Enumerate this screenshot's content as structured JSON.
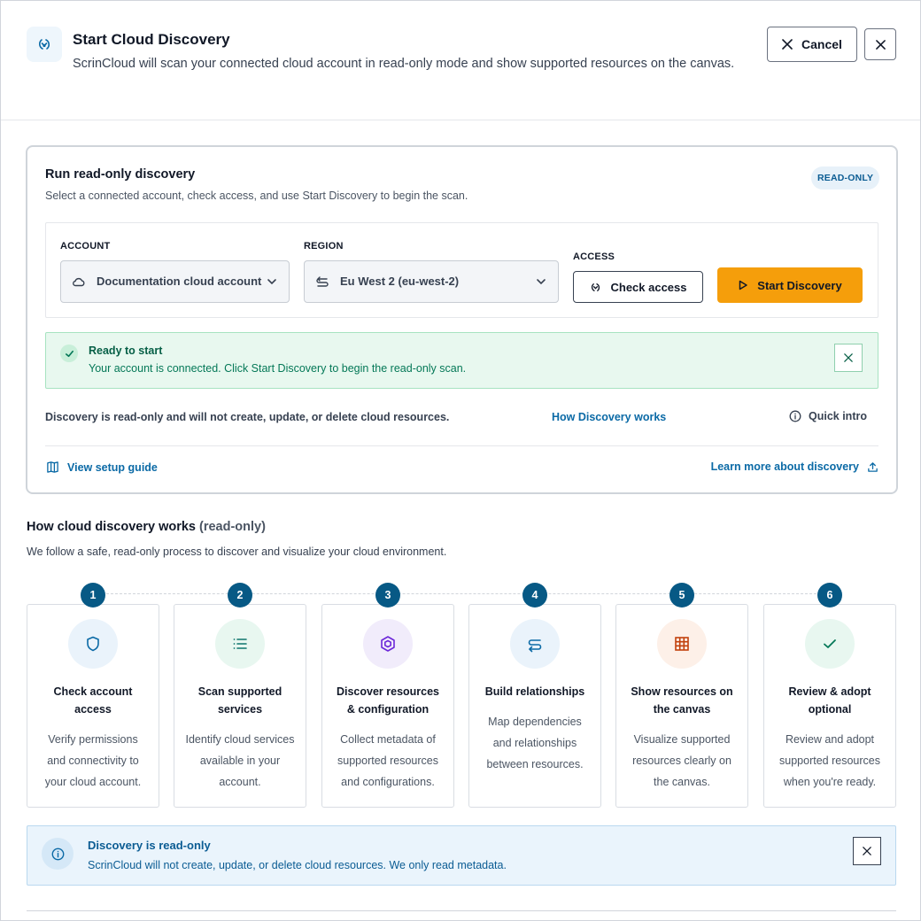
{
  "header": {
    "title": "Start Cloud Discovery",
    "subtitle": "ScrinCloud will scan your connected cloud account in read-only mode and show supported resources on the canvas.",
    "cancel_label": "Cancel",
    "icon": "discovery-icon"
  },
  "discovery": {
    "title": "Run read-only discovery",
    "subtitle": "Select a connected account, check access, and use Start Discovery to begin the scan.",
    "badge": "READ-ONLY",
    "account_label": "ACCOUNT",
    "account_value": "Documentation cloud account",
    "region_label": "REGION",
    "region_value": "Eu West 2 (eu-west-2)",
    "access_label": "ACCESS",
    "check_access_label": "Check access",
    "start_label": "Start Discovery"
  },
  "status": {
    "title": "Ready to start",
    "message": "Your account is connected. Click Start Discovery to begin the read-only scan."
  },
  "footer_links": {
    "note": "Discovery is read-only and will not create, update, or delete cloud resources.",
    "how_link": "How Discovery works",
    "quick_intro": "Quick intro",
    "setup_guide": "View setup guide",
    "learn_more": "Learn more about discovery"
  },
  "how": {
    "title": "How cloud discovery works",
    "title_suffix": "(read-only)",
    "subtitle": "We follow a safe, read-only process to discover and visualize your cloud environment.",
    "steps": [
      {
        "num": "1",
        "title": "Check account access",
        "desc": "Verify permissions and connectivity to your cloud account.",
        "icon": "shield-icon",
        "color": "#0b6aa6",
        "bg": "#eaf3fb"
      },
      {
        "num": "2",
        "title": "Scan supported services",
        "desc": "Identify cloud services available in your account.",
        "icon": "list-icon",
        "color": "#0f766e",
        "bg": "#e8f7f0"
      },
      {
        "num": "3",
        "title": "Discover resources & configuration",
        "desc": "Collect metadata of supported resources and configurations.",
        "icon": "hexagon-icon",
        "color": "#6d28d9",
        "bg": "#f1ecfb"
      },
      {
        "num": "4",
        "title": "Build relationships",
        "desc": "Map dependencies and relationships between resources.",
        "icon": "link-icon",
        "color": "#0b6aa6",
        "bg": "#eaf3fb"
      },
      {
        "num": "5",
        "title": "Show resources on the canvas",
        "desc": "Visualize supported resources clearly on the canvas.",
        "icon": "grid-icon",
        "color": "#c2410c",
        "bg": "#fdf0e8"
      },
      {
        "num": "6",
        "title": "Review & adopt optional",
        "desc": "Review and adopt supported resources when you're ready.",
        "icon": "check-icon",
        "color": "#047857",
        "bg": "#e8f7f0"
      }
    ]
  },
  "info": {
    "title": "Discovery is read-only",
    "message": "ScrinCloud will not create, update, or delete cloud resources. We only read metadata."
  }
}
